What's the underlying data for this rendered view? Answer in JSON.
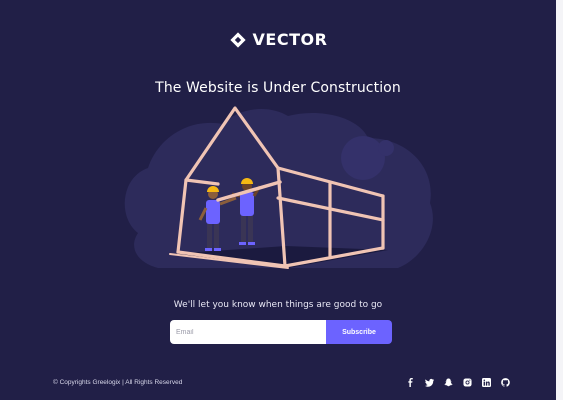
{
  "brand": {
    "name": "VECTOR"
  },
  "hero": {
    "title": "The Website is Under Construction"
  },
  "notify": {
    "text": "We'll let you know when things are good to go",
    "email_placeholder": "Email",
    "subscribe_label": "Subscribe"
  },
  "footer": {
    "copyright": "© Copyrights Greelogix | All Rights Reserved",
    "socials": [
      "facebook-icon",
      "twitter-icon",
      "snapchat-icon",
      "instagram-icon",
      "linkedin-icon",
      "github-icon"
    ]
  },
  "colors": {
    "background": "#211f47",
    "blob": "#2d2b5b",
    "accent": "#6c63ff",
    "frame": "#f0c4b4",
    "worker_vest": "#6c63ff",
    "helmet": "#f5b814"
  }
}
